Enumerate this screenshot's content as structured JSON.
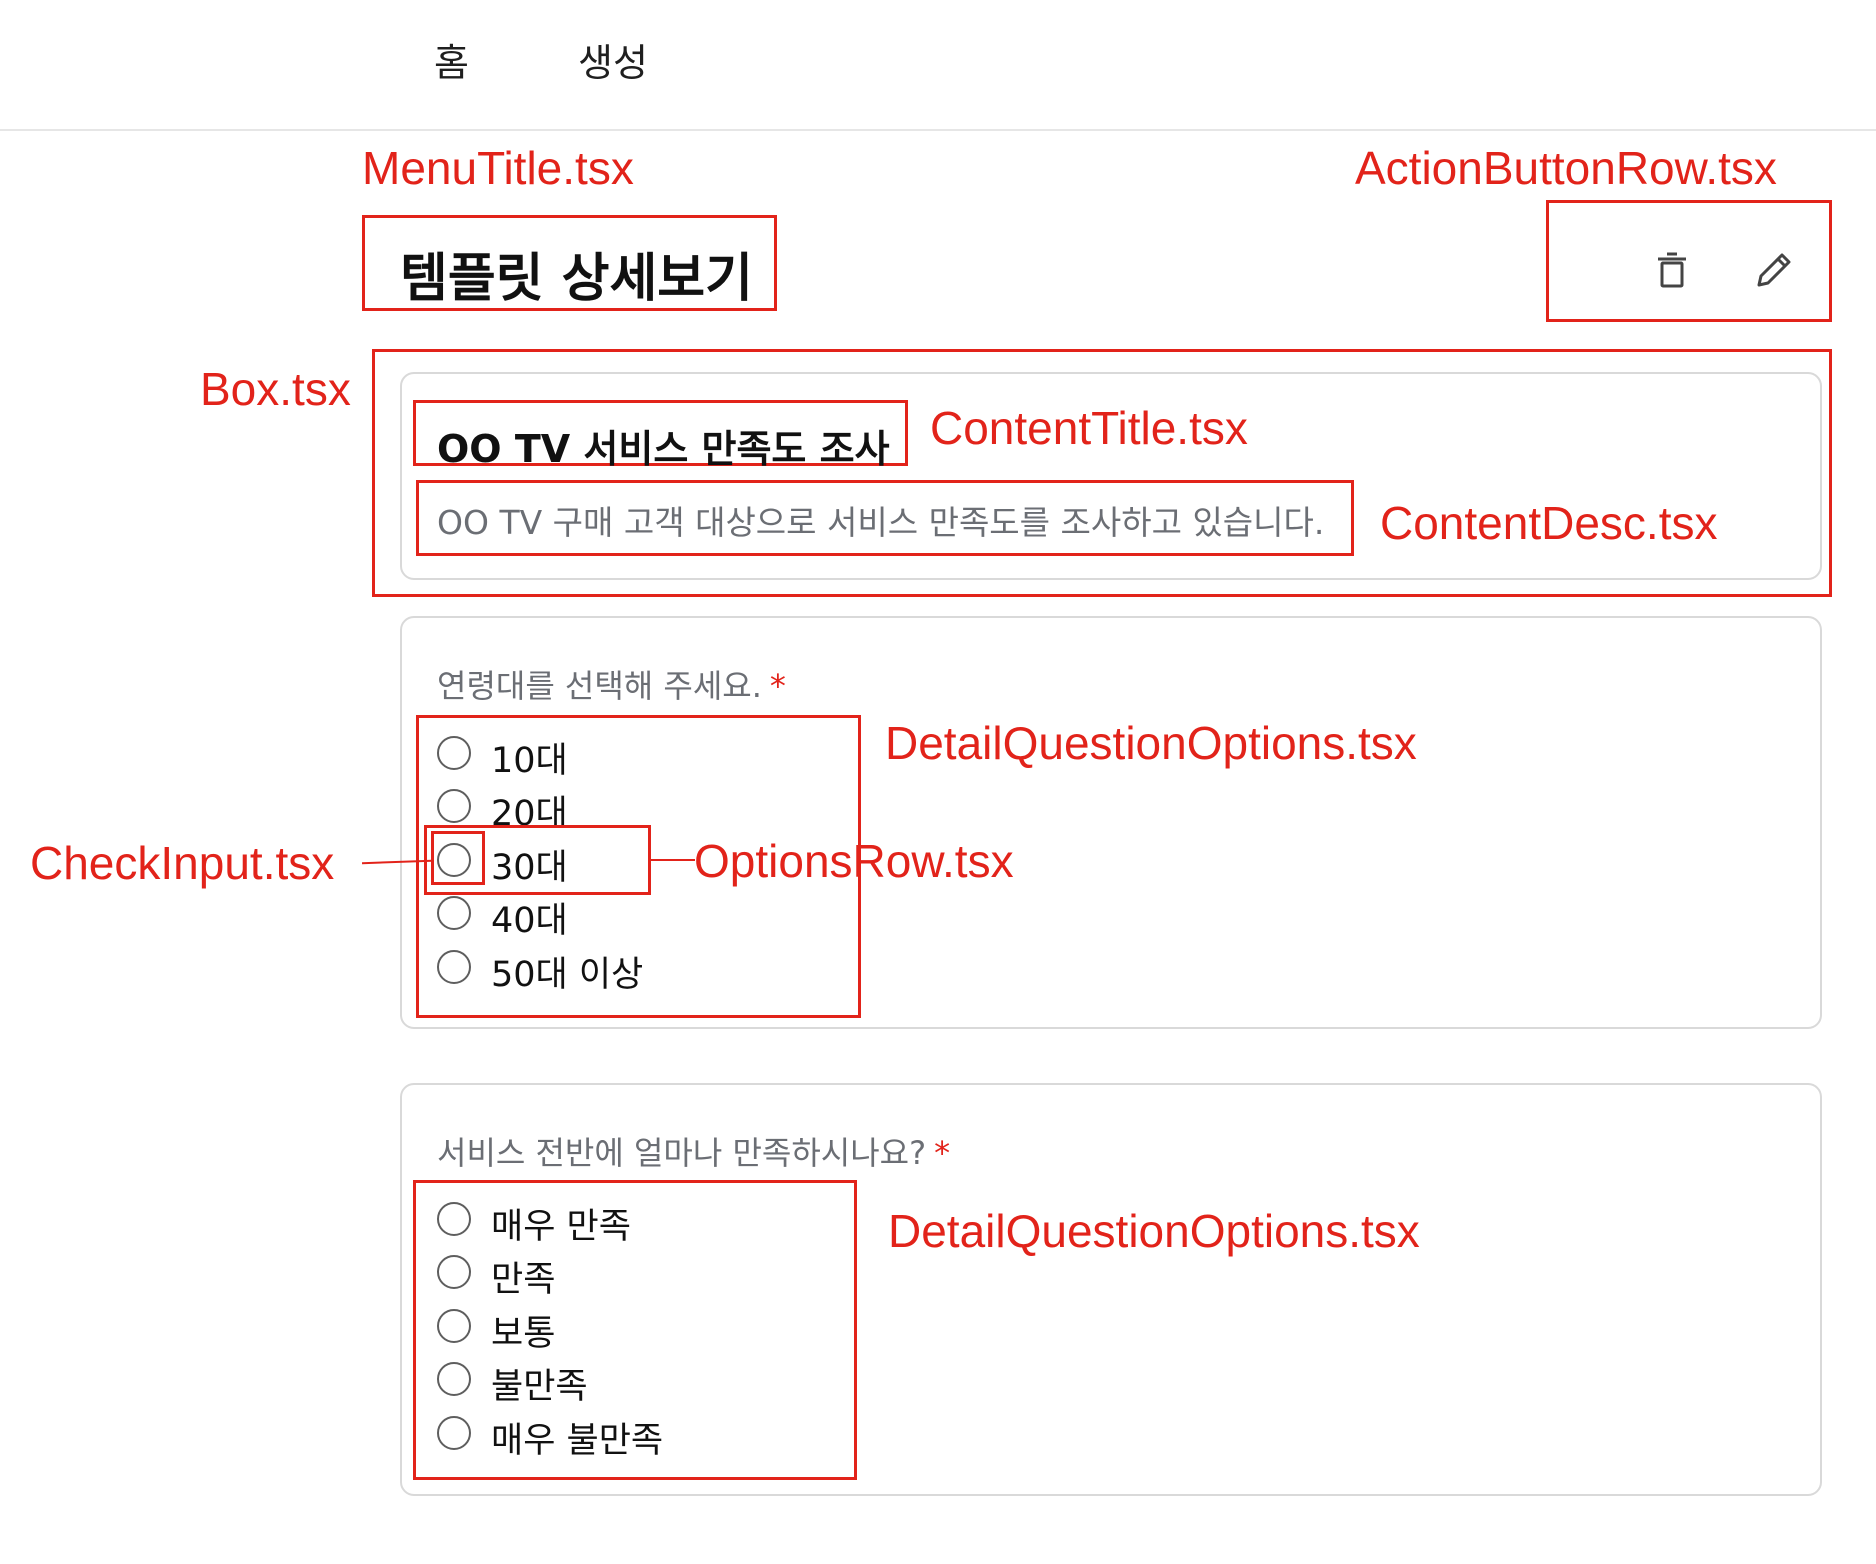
{
  "nav": {
    "home": "홈",
    "create": "생성"
  },
  "page": {
    "title": "템플릿 상세보기"
  },
  "actions": {
    "delete_icon": "trash-icon",
    "edit_icon": "pencil-icon"
  },
  "survey": {
    "title": "OO TV 서비스 만족도 조사",
    "description": "OO TV 구매 고객 대상으로 서비스 만족도를 조사하고 있습니다."
  },
  "questions": [
    {
      "text": "연령대를 선택해 주세요.",
      "required_mark": "*",
      "options": [
        "10대",
        "20대",
        "30대",
        "40대",
        "50대 이상"
      ]
    },
    {
      "text": "서비스 전반에 얼마나 만족하시나요?",
      "required_mark": "*",
      "options": [
        "매우 만족",
        "만족",
        "보통",
        "불만족",
        "매우 불만족"
      ]
    }
  ],
  "annotations": {
    "menu_title": "MenuTitle.tsx",
    "action_button_row": "ActionButtonRow.tsx",
    "box": "Box.tsx",
    "content_title": "ContentTitle.tsx",
    "content_desc": "ContentDesc.tsx",
    "detail_question_options_1": "DetailQuestionOptions.tsx",
    "check_input": "CheckInput.tsx",
    "options_row": "OptionsRow.tsx",
    "detail_question_options_2": "DetailQuestionOptions.tsx"
  },
  "colors": {
    "annotation_red": "#e2231a",
    "card_border": "#d9d9d9",
    "muted_text": "#6b6e74"
  }
}
